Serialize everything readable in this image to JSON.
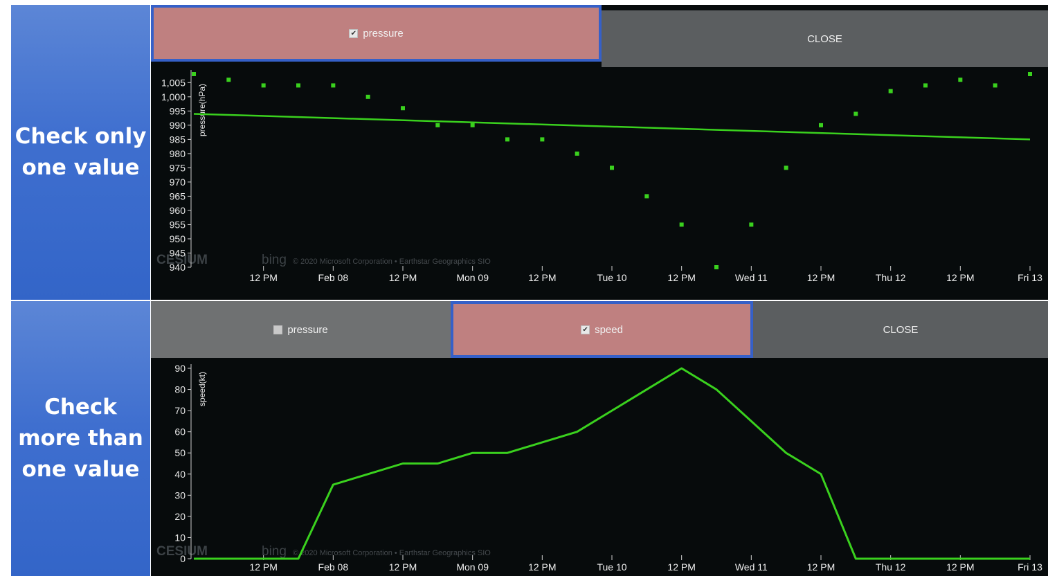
{
  "side_labels": {
    "top": "Check only\none value",
    "bottom": "Check\nmore than\none value"
  },
  "top_panel": {
    "tabs": [
      {
        "label": "pressure",
        "checked": true,
        "selected": true
      }
    ],
    "close_label": "CLOSE"
  },
  "bottom_panel": {
    "tabs": [
      {
        "label": "pressure",
        "checked": false,
        "selected": false
      },
      {
        "label": "speed",
        "checked": true,
        "selected": true
      }
    ],
    "close_label": "CLOSE"
  },
  "attribution": {
    "cesium": "CESIUM",
    "bing": "bing",
    "copyright": "© 2020 Microsoft Corporation • Earthstar Geographics SIO"
  },
  "colors": {
    "series": "#3ad11e",
    "accent_border": "#3560c8",
    "selected_tab": "#bf8080"
  },
  "chart_data": [
    {
      "type": "scatter",
      "title": "",
      "ylabel": "pressure(hPa)",
      "xlabel": "",
      "ylim": [
        940,
        1008
      ],
      "x_ticks": [
        "12 PM",
        "Feb 08",
        "12 PM",
        "Mon 09",
        "12 PM",
        "Tue 10",
        "12 PM",
        "Wed 11",
        "12 PM",
        "Thu 12",
        "12 PM",
        "Fri 13"
      ],
      "y_ticks": [
        "940",
        "945",
        "950",
        "955",
        "960",
        "965",
        "970",
        "975",
        "980",
        "985",
        "990",
        "995",
        "1,000",
        "1,005"
      ],
      "y_tick_values": [
        940,
        945,
        950,
        955,
        960,
        965,
        970,
        975,
        980,
        985,
        990,
        995,
        1000,
        1005
      ],
      "series": [
        {
          "kind": "points",
          "values": [
            1008,
            1006,
            1004,
            1004,
            1004,
            1000,
            996,
            990,
            990,
            985,
            985,
            980,
            975,
            965,
            955,
            940,
            955,
            975,
            990,
            994,
            1002,
            1004,
            1006,
            1004,
            1008
          ]
        },
        {
          "kind": "trend",
          "values": [
            994,
            985
          ]
        }
      ]
    },
    {
      "type": "line",
      "title": "",
      "ylabel": "speed(kt)",
      "xlabel": "",
      "ylim": [
        0,
        90
      ],
      "x_ticks": [
        "12 PM",
        "Feb 08",
        "12 PM",
        "Mon 09",
        "12 PM",
        "Tue 10",
        "12 PM",
        "Wed 11",
        "12 PM",
        "Thu 12",
        "12 PM",
        "Fri 13"
      ],
      "y_ticks": [
        "0",
        "10",
        "20",
        "30",
        "40",
        "50",
        "60",
        "70",
        "80",
        "90"
      ],
      "y_tick_values": [
        0,
        10,
        20,
        30,
        40,
        50,
        60,
        70,
        80,
        90
      ],
      "series": [
        {
          "kind": "line",
          "values": [
            0,
            0,
            0,
            0,
            35,
            40,
            45,
            45,
            50,
            50,
            55,
            60,
            70,
            80,
            90,
            80,
            65,
            50,
            40,
            0,
            0,
            0,
            0,
            0,
            0
          ]
        }
      ]
    }
  ]
}
